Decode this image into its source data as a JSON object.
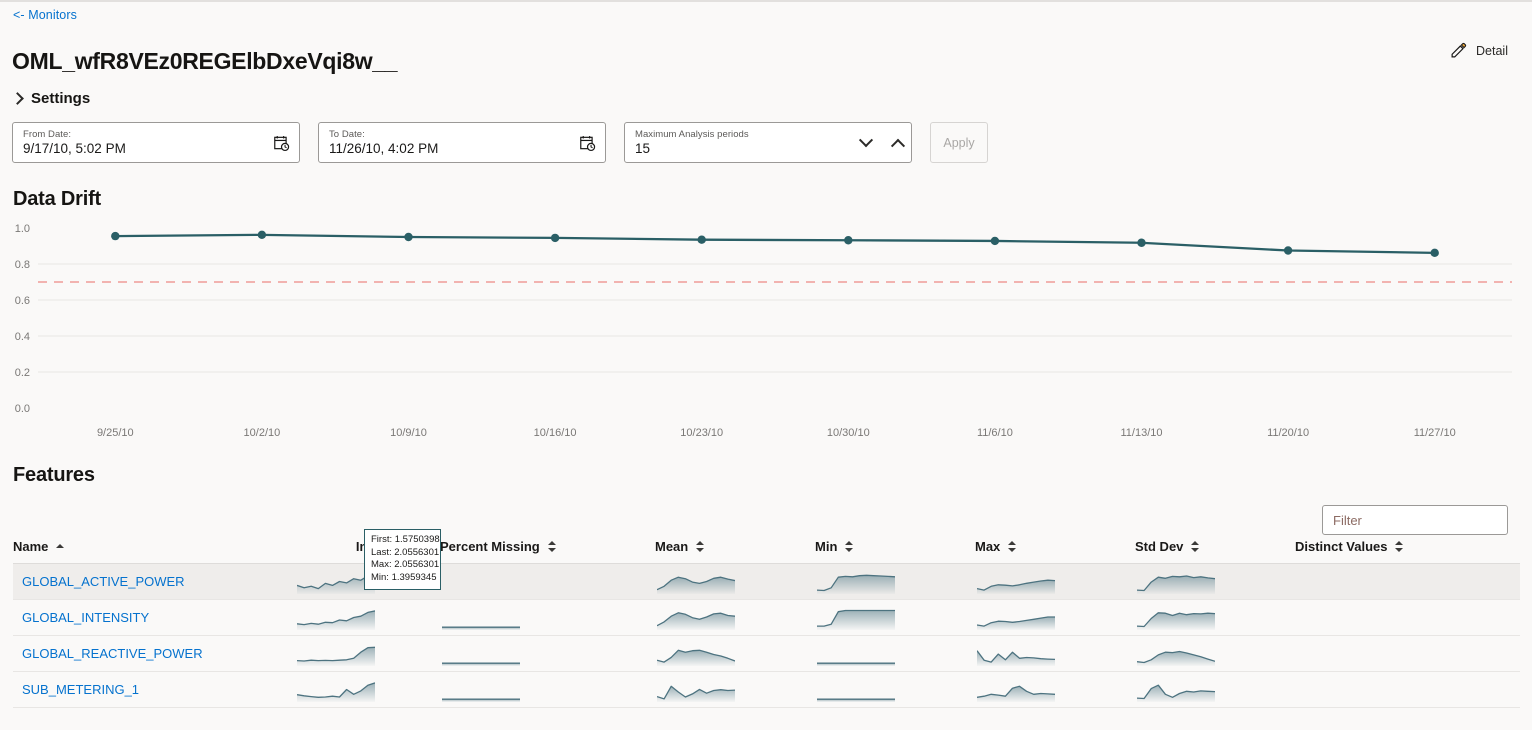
{
  "breadcrumb": {
    "label": "<- Monitors"
  },
  "header": {
    "title": "OML_wfR8VEz0REGElbDxeVqi8w__",
    "detail_label": "Detail"
  },
  "settings": {
    "label": "Settings"
  },
  "controls": {
    "from_date": {
      "label": "From Date:",
      "value": "9/17/10, 5:02 PM"
    },
    "to_date": {
      "label": "To Date:",
      "value": "11/26/10, 4:02 PM"
    },
    "max_periods": {
      "label": "Maximum Analysis periods",
      "value": "15"
    },
    "apply_label": "Apply"
  },
  "drift": {
    "title": "Data Drift"
  },
  "features": {
    "title": "Features",
    "filter_placeholder": "Filter",
    "columns": [
      {
        "label": "Name",
        "sort": "asc"
      },
      {
        "label": "Importance",
        "sort": "none"
      },
      {
        "label": "Percent Missing",
        "sort": "both"
      },
      {
        "label": "Mean",
        "sort": "both"
      },
      {
        "label": "Min",
        "sort": "both"
      },
      {
        "label": "Max",
        "sort": "both"
      },
      {
        "label": "Std Dev",
        "sort": "both"
      },
      {
        "label": "Distinct Values",
        "sort": "both"
      }
    ],
    "rows": [
      {
        "name": "GLOBAL_ACTIVE_POWER",
        "highlight": true
      },
      {
        "name": "GLOBAL_INTENSITY",
        "highlight": false
      },
      {
        "name": "GLOBAL_REACTIVE_POWER",
        "highlight": false
      },
      {
        "name": "SUB_METERING_1",
        "highlight": false
      }
    ]
  },
  "tooltip": {
    "first": "First: 1.5750398",
    "last": "Last: 2.0556301",
    "max": "Max: 2.0556301",
    "min": "Min: 1.3959345"
  },
  "colors": {
    "link": "#0572ce",
    "line": "#2a5f66",
    "threshold": "#f2b3b0",
    "grid": "#e8e6e4",
    "spark": "#7e9aa3",
    "background": "#faf9f8"
  },
  "chart_data": {
    "type": "line",
    "title": "Data Drift",
    "xlabel": "",
    "ylabel": "",
    "ylim": [
      0.0,
      1.0
    ],
    "yticks": [
      "0.0",
      "0.2",
      "0.4",
      "0.6",
      "0.8",
      "1.0"
    ],
    "grid": true,
    "legend": "none",
    "x": [
      "9/25/10",
      "10/2/10",
      "10/9/10",
      "10/16/10",
      "10/23/10",
      "10/30/10",
      "11/6/10",
      "11/13/10",
      "11/20/10",
      "11/27/10"
    ],
    "series": [
      {
        "name": "Drift",
        "values": [
          0.955,
          0.962,
          0.95,
          0.945,
          0.935,
          0.932,
          0.928,
          0.918,
          0.875,
          0.862
        ]
      }
    ],
    "threshold": {
      "label": "",
      "value": 0.7,
      "style": "dashed",
      "color": "#f2b3b0"
    }
  },
  "sparklines": {
    "importance": [
      [
        0.35,
        0.22,
        0.3,
        0.18,
        0.45,
        0.35,
        0.55,
        0.48,
        0.7,
        0.62,
        0.85,
        0.92
      ],
      [
        0.22,
        0.18,
        0.24,
        0.2,
        0.3,
        0.28,
        0.42,
        0.38,
        0.55,
        0.62,
        0.82,
        0.9
      ],
      [
        0.18,
        0.16,
        0.2,
        0.18,
        0.19,
        0.18,
        0.2,
        0.22,
        0.3,
        0.62,
        0.86,
        0.88
      ],
      [
        0.28,
        0.22,
        0.18,
        0.14,
        0.16,
        0.2,
        0.16,
        0.55,
        0.3,
        0.48,
        0.78,
        0.9
      ]
    ],
    "percent_missing": [
      null,
      [
        0.04,
        0.04,
        0.04,
        0.04,
        0.04,
        0.04,
        0.04,
        0.04,
        0.04,
        0.04,
        0.04,
        0.04
      ],
      [
        0.04,
        0.04,
        0.04,
        0.04,
        0.04,
        0.04,
        0.04,
        0.04,
        0.04,
        0.04,
        0.04,
        0.04
      ],
      [
        0.04,
        0.04,
        0.04,
        0.04,
        0.04,
        0.04,
        0.04,
        0.04,
        0.04,
        0.04,
        0.04,
        0.04
      ]
    ],
    "mean": [
      [
        0.12,
        0.3,
        0.62,
        0.78,
        0.7,
        0.52,
        0.45,
        0.55,
        0.72,
        0.78,
        0.68,
        0.6
      ],
      [
        0.12,
        0.32,
        0.62,
        0.8,
        0.72,
        0.54,
        0.46,
        0.58,
        0.74,
        0.78,
        0.66,
        0.62
      ],
      [
        0.2,
        0.1,
        0.35,
        0.72,
        0.62,
        0.7,
        0.72,
        0.62,
        0.5,
        0.42,
        0.3,
        0.16
      ],
      [
        0.18,
        0.06,
        0.72,
        0.42,
        0.16,
        0.32,
        0.56,
        0.36,
        0.5,
        0.54,
        0.5,
        0.52
      ]
    ],
    "min": [
      [
        0.1,
        0.08,
        0.22,
        0.78,
        0.82,
        0.8,
        0.86,
        0.88,
        0.86,
        0.84,
        0.82,
        0.8
      ],
      [
        0.1,
        0.1,
        0.2,
        0.86,
        0.92,
        0.92,
        0.92,
        0.92,
        0.92,
        0.92,
        0.92,
        0.92
      ],
      [
        0.04,
        0.04,
        0.04,
        0.04,
        0.04,
        0.04,
        0.04,
        0.04,
        0.04,
        0.04,
        0.04,
        0.04
      ],
      [
        0.04,
        0.04,
        0.04,
        0.04,
        0.04,
        0.04,
        0.04,
        0.04,
        0.04,
        0.04,
        0.04,
        0.04
      ]
    ],
    "max": [
      [
        0.18,
        0.1,
        0.3,
        0.38,
        0.36,
        0.32,
        0.38,
        0.46,
        0.52,
        0.58,
        0.62,
        0.6
      ],
      [
        0.16,
        0.1,
        0.28,
        0.36,
        0.34,
        0.3,
        0.34,
        0.4,
        0.46,
        0.52,
        0.58,
        0.58
      ],
      [
        0.7,
        0.2,
        0.1,
        0.52,
        0.22,
        0.62,
        0.3,
        0.34,
        0.32,
        0.28,
        0.26,
        0.24
      ],
      [
        0.14,
        0.2,
        0.3,
        0.26,
        0.2,
        0.62,
        0.72,
        0.46,
        0.3,
        0.34,
        0.32,
        0.3
      ]
    ],
    "std_dev": [
      [
        0.1,
        0.08,
        0.52,
        0.78,
        0.72,
        0.82,
        0.8,
        0.84,
        0.76,
        0.8,
        0.74,
        0.7
      ],
      [
        0.1,
        0.08,
        0.5,
        0.8,
        0.78,
        0.66,
        0.78,
        0.7,
        0.76,
        0.74,
        0.78,
        0.76
      ],
      [
        0.12,
        0.08,
        0.22,
        0.48,
        0.62,
        0.6,
        0.66,
        0.58,
        0.48,
        0.38,
        0.26,
        0.14
      ],
      [
        0.1,
        0.08,
        0.6,
        0.78,
        0.3,
        0.14,
        0.34,
        0.46,
        0.42,
        0.48,
        0.46,
        0.44
      ]
    ],
    "distinct_values": [
      null,
      null,
      null,
      null
    ]
  }
}
